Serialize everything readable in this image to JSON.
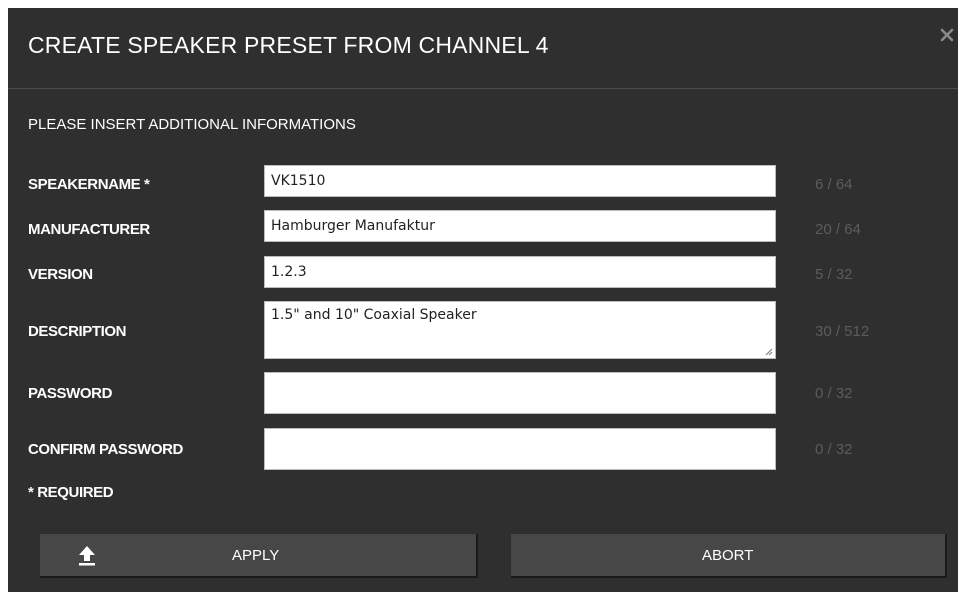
{
  "dialog": {
    "title": "CREATE SPEAKER PRESET FROM CHANNEL 4",
    "close_icon": "close-icon",
    "subtitle": "PLEASE INSERT ADDITIONAL INFORMATIONS"
  },
  "fields": [
    {
      "label": "SPEAKERNAME *",
      "value": "VK1510",
      "counter": "6 / 64"
    },
    {
      "label": "MANUFACTURER",
      "value": "Hamburger Manufaktur",
      "counter": "20 / 64"
    },
    {
      "label": "VERSION",
      "value": "1.2.3",
      "counter": "5 / 32"
    },
    {
      "label": "DESCRIPTION",
      "value": "1.5\" and 10\" Coaxial Speaker",
      "counter": "30 / 512"
    },
    {
      "label": "PASSWORD",
      "value": "",
      "counter": "0 / 32"
    },
    {
      "label": "CONFIRM PASSWORD",
      "value": "",
      "counter": "0 / 32"
    }
  ],
  "required_note": "* REQUIRED",
  "buttons": {
    "apply_label": "APPLY",
    "apply_icon": "upload-icon",
    "abort_label": "ABORT"
  },
  "colors": {
    "dialog_bg": "#2f2f2f",
    "button_bg": "#474747",
    "counter_text": "#5c5c5c",
    "field_bg": "#ffffff"
  }
}
